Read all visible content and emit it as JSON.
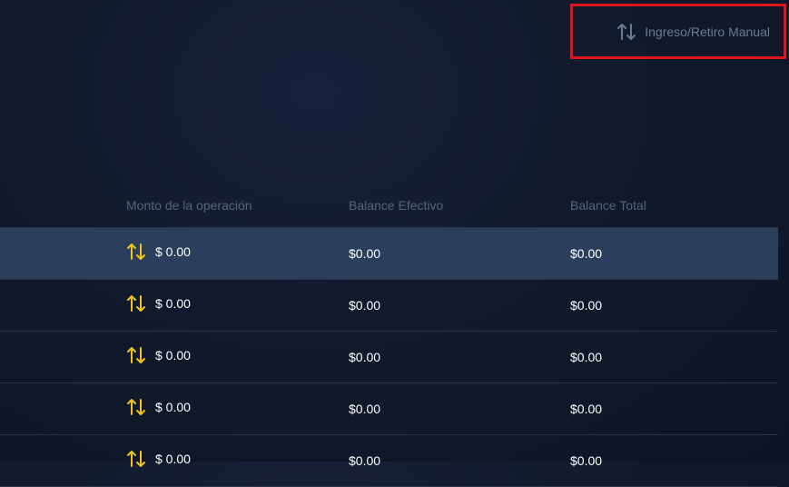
{
  "top_action": {
    "label": "Ingreso/Retiro Manual",
    "icon": "transfer-arrows-icon",
    "icon_color": "#6b7a93",
    "highlight_color": "#e0141b"
  },
  "table": {
    "columns": {
      "amount": "Monto de la operación",
      "effective_balance": "Balance Efectivo",
      "total_balance": "Balance Total"
    },
    "row_icon": "transfer-arrows-icon",
    "row_icon_color": "#f2c417",
    "selected_row_color": "#2b3e5c",
    "rows": [
      {
        "amount": "$ 0.00",
        "effective_balance": "$0.00",
        "total_balance": "$0.00"
      },
      {
        "amount": "$ 0.00",
        "effective_balance": "$0.00",
        "total_balance": "$0.00"
      },
      {
        "amount": "$ 0.00",
        "effective_balance": "$0.00",
        "total_balance": "$0.00"
      },
      {
        "amount": "$ 0.00",
        "effective_balance": "$0.00",
        "total_balance": "$0.00"
      },
      {
        "amount": "$ 0.00",
        "effective_balance": "$0.00",
        "total_balance": "$0.00"
      }
    ]
  }
}
